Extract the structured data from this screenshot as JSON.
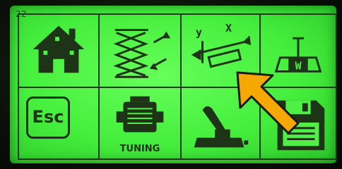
{
  "screen": {
    "page_indicator": "22",
    "lcd_color": "#4ef045",
    "ink_color": "#1e3416",
    "pointer_color": "#f5a800"
  },
  "menu": {
    "items": [
      {
        "icon": "home-icon"
      },
      {
        "icon": "scissor-lift-icon"
      },
      {
        "icon": "xy-axis-tilt-icon",
        "x_label": "X",
        "y_label": "y"
      },
      {
        "icon": "weight-scale-icon"
      },
      {
        "icon": "escape-icon",
        "label": "Esc"
      },
      {
        "icon": "engine-icon",
        "label": "TUNING"
      },
      {
        "icon": "joystick-icon"
      },
      {
        "icon": "save-icon"
      }
    ]
  },
  "annotation": {
    "icon": "arrow-pointer-icon"
  }
}
